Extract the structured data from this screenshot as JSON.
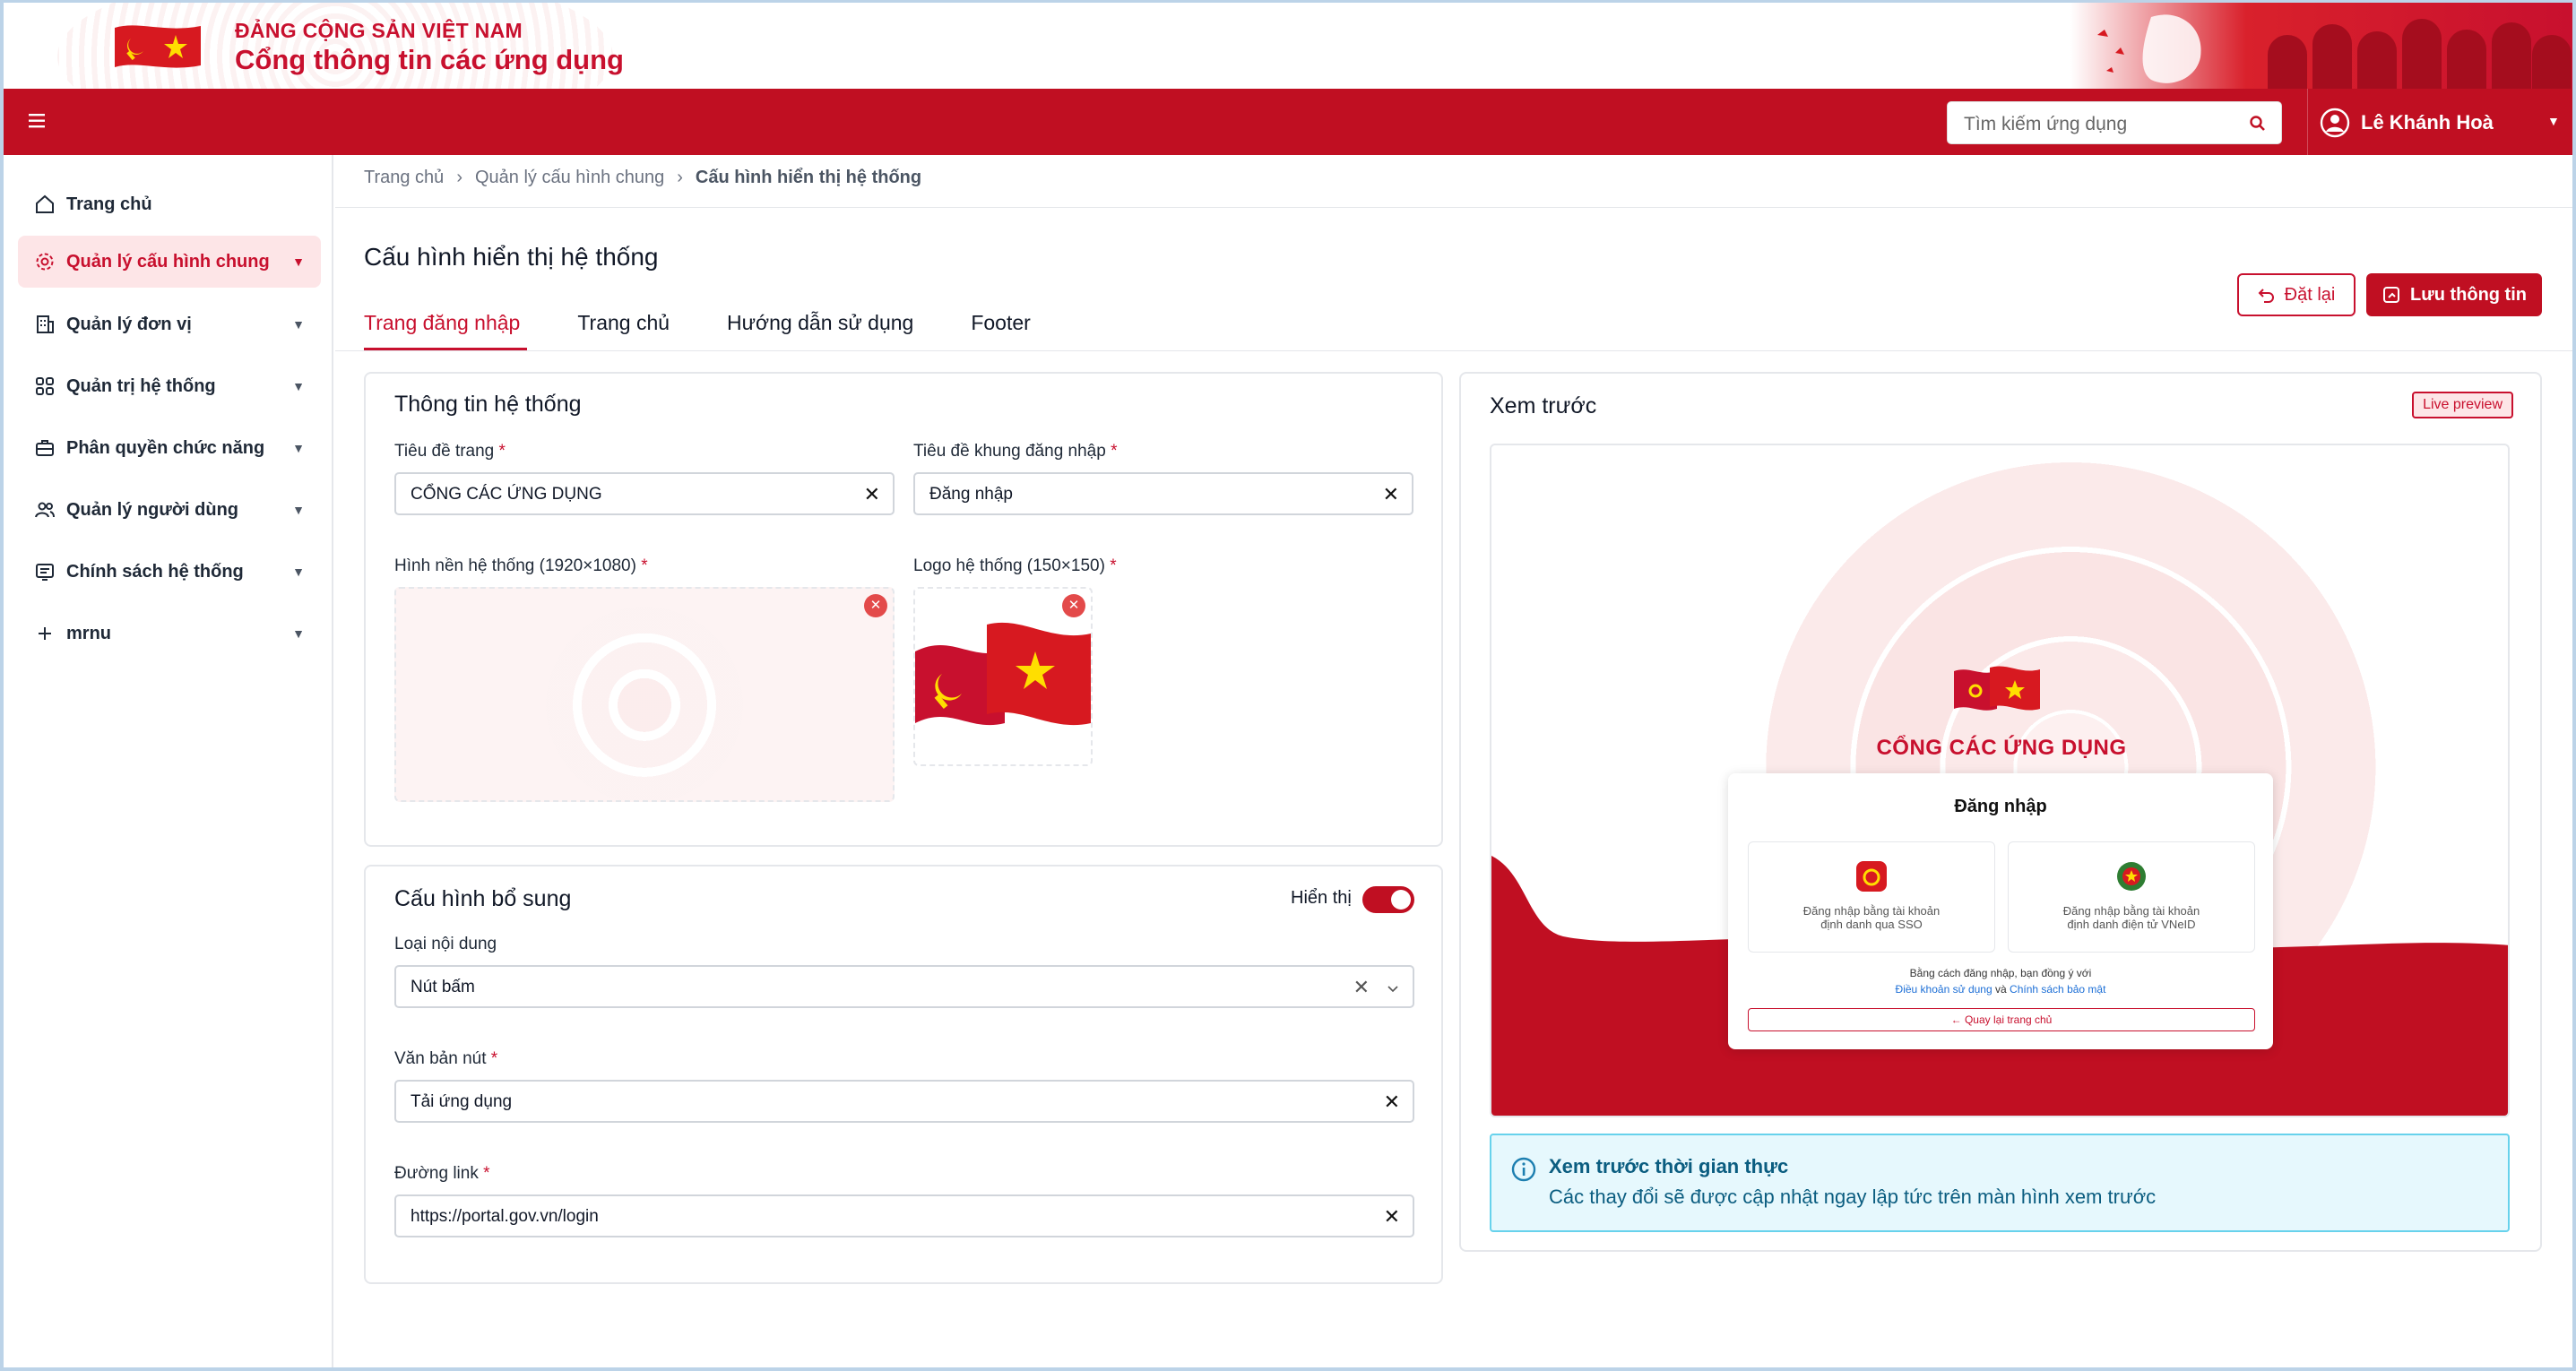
{
  "header": {
    "org": "ĐẢNG CỘNG SẢN VIỆT NAM",
    "title": "Cổng thông tin các ứng dụng"
  },
  "navbar": {
    "search_placeholder": "Tìm kiếm ứng dụng",
    "user_name": "Lê Khánh Hoà"
  },
  "sidebar": {
    "items": [
      {
        "label": "Trang chủ",
        "icon": "home-icon"
      },
      {
        "label": "Quản lý cấu hình chung",
        "icon": "gear-icon",
        "active": true
      },
      {
        "label": "Quản lý đơn vị",
        "icon": "building-icon"
      },
      {
        "label": "Quản trị hệ thống",
        "icon": "grid-icon"
      },
      {
        "label": "Phân quyền chức năng",
        "icon": "briefcase-icon"
      },
      {
        "label": "Quản lý người dùng",
        "icon": "users-icon"
      },
      {
        "label": "Chính sách hệ thống",
        "icon": "policy-icon"
      },
      {
        "label": "mrnu",
        "icon": "plus-icon"
      }
    ]
  },
  "breadcrumb": [
    "Trang chủ",
    "Quản lý cấu hình chung",
    "Cấu hình hiển thị hệ thống"
  ],
  "page": {
    "title": "Cấu hình hiển thị hệ thống",
    "reset_label": "Đặt lại",
    "save_label": "Lưu thông tin",
    "tabs": [
      "Trang đăng nhập",
      "Trang chủ",
      "Hướng dẫn sử dụng",
      "Footer"
    ]
  },
  "system_info": {
    "heading": "Thông tin hệ thống",
    "page_title_label": "Tiêu đề trang",
    "page_title_value": "CỔNG CÁC ỨNG DỤNG",
    "login_title_label": "Tiêu đề khung đăng nhập",
    "login_title_value": "Đăng nhập",
    "bg_label": "Hình nền hệ thống (1920×1080)",
    "logo_label": "Logo hệ thống (150×150)"
  },
  "extra": {
    "heading": "Cấu hình bổ sung",
    "toggle_label": "Hiển thị",
    "toggle_on": true,
    "content_type_label": "Loại nội dung",
    "content_type_value": "Nút bấm",
    "button_text_label": "Văn bản nút",
    "button_text_value": "Tải ứng dụng",
    "link_label": "Đường link",
    "link_value": "https://portal.gov.vn/login"
  },
  "preview": {
    "heading": "Xem trước",
    "badge": "Live preview",
    "portal_title": "CỔNG CÁC ỨNG DỤNG",
    "login_heading": "Đăng nhập",
    "sso_line1": "Đăng nhập bằng tài khoản",
    "sso_line2": "định danh qua SSO",
    "vneid_line1": "Đăng nhập bằng tài khoản",
    "vneid_line2": "định danh điện tử VNeID",
    "agree_text": "Bằng cách đăng nhập, bạn đồng ý với",
    "terms": "Điều khoản sử dụng",
    "and": "và",
    "privacy": "Chính sách bảo mật",
    "back_label": "Quay lại trang chủ",
    "info_title": "Xem trước thời gian thực",
    "info_desc": "Các thay đổi sẽ được cập nhật ngay lập tức trên màn hình xem trước"
  },
  "colors": {
    "brand": "#c00f22",
    "accent_light": "#fde5e7",
    "info": "#0b5d80"
  }
}
